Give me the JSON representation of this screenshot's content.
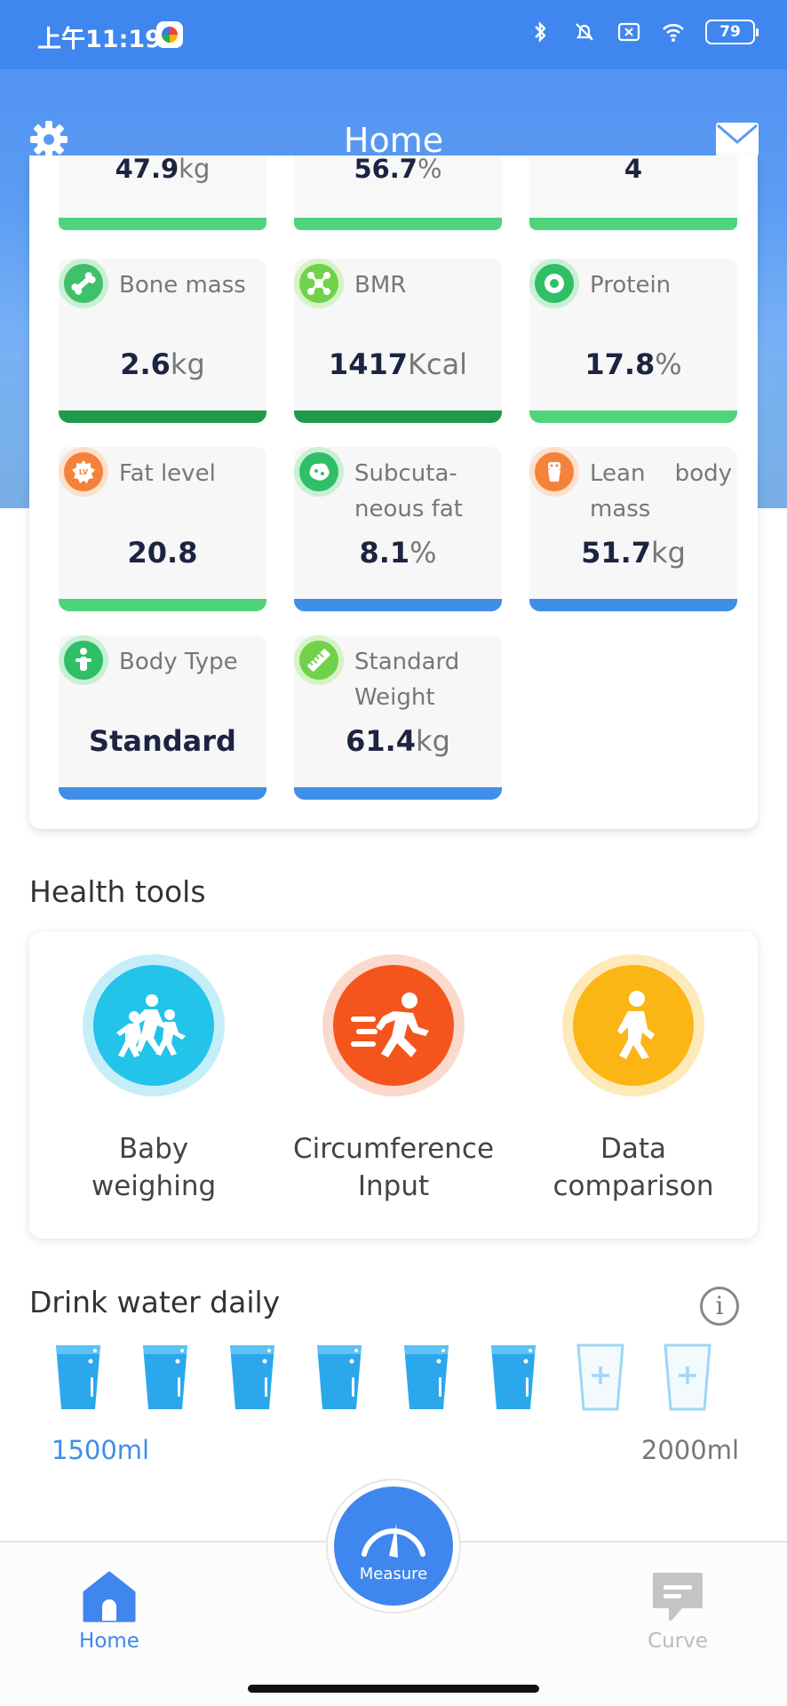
{
  "status_bar": {
    "time": "上午11:19",
    "battery": "79"
  },
  "header": {
    "title": "Home"
  },
  "metrics": {
    "top_partial": [
      {
        "value": "47.9",
        "unit": "kg",
        "bar_color": "#4fd47c"
      },
      {
        "value": "56.7",
        "unit": "%",
        "bar_color": "#4fd47c"
      },
      {
        "value": "4",
        "unit": "",
        "bar_color": "#4fd47c"
      }
    ],
    "tiles": [
      {
        "label": "Bone mass",
        "value": "2.6",
        "unit": "kg",
        "icon": "bone-icon",
        "bar_color": "#1e9a4a"
      },
      {
        "label": "BMR",
        "value": "1417",
        "unit": "Kcal",
        "icon": "bmr-icon",
        "bar_color": "#1e9a4a"
      },
      {
        "label": "Protein",
        "value": "17.8",
        "unit": "%",
        "icon": "protein-icon",
        "bar_color": "#4fd47c"
      },
      {
        "label": "Fat level",
        "value": "20.8",
        "unit": "",
        "icon": "fat-level-icon",
        "bar_color": "#4fd47c"
      },
      {
        "label": "Subcuta- neous fat",
        "value": "8.1",
        "unit": "%",
        "icon": "subcutaneous-fat-icon",
        "bar_color": "#3f8ee8"
      },
      {
        "label": "Lean body mass",
        "value": "51.7",
        "unit": "kg",
        "icon": "lean-body-mass-icon",
        "bar_color": "#3f8ee8"
      },
      {
        "label": "Body Type",
        "value": "Standard",
        "unit": "",
        "icon": "body-type-icon",
        "bar_color": "#3f8ee8"
      },
      {
        "label": "Standard Weight",
        "value": "61.4",
        "unit": "kg",
        "icon": "ruler-icon",
        "bar_color": "#3f8ee8"
      }
    ]
  },
  "health_tools": {
    "title": "Health tools",
    "items": [
      {
        "label_line1": "Baby",
        "label_line2": "weighing",
        "icon": "family-running-icon"
      },
      {
        "label_line1": "Circumference",
        "label_line2": "Input",
        "icon": "runner-icon"
      },
      {
        "label_line1": "Data",
        "label_line2": "comparison",
        "icon": "walker-icon"
      }
    ]
  },
  "water": {
    "title": "Drink water daily",
    "current": "1500ml",
    "target": "2000ml",
    "filled_cups": 6,
    "total_cups": 8
  },
  "tabbar": {
    "home_label": "Home",
    "measure_label": "Measure",
    "curve_label": "Curve"
  },
  "colors": {
    "accent": "#3f86ee",
    "green_dark": "#1e9a4a",
    "green_light": "#4fd47c",
    "blue_bar": "#3f8ee8"
  }
}
